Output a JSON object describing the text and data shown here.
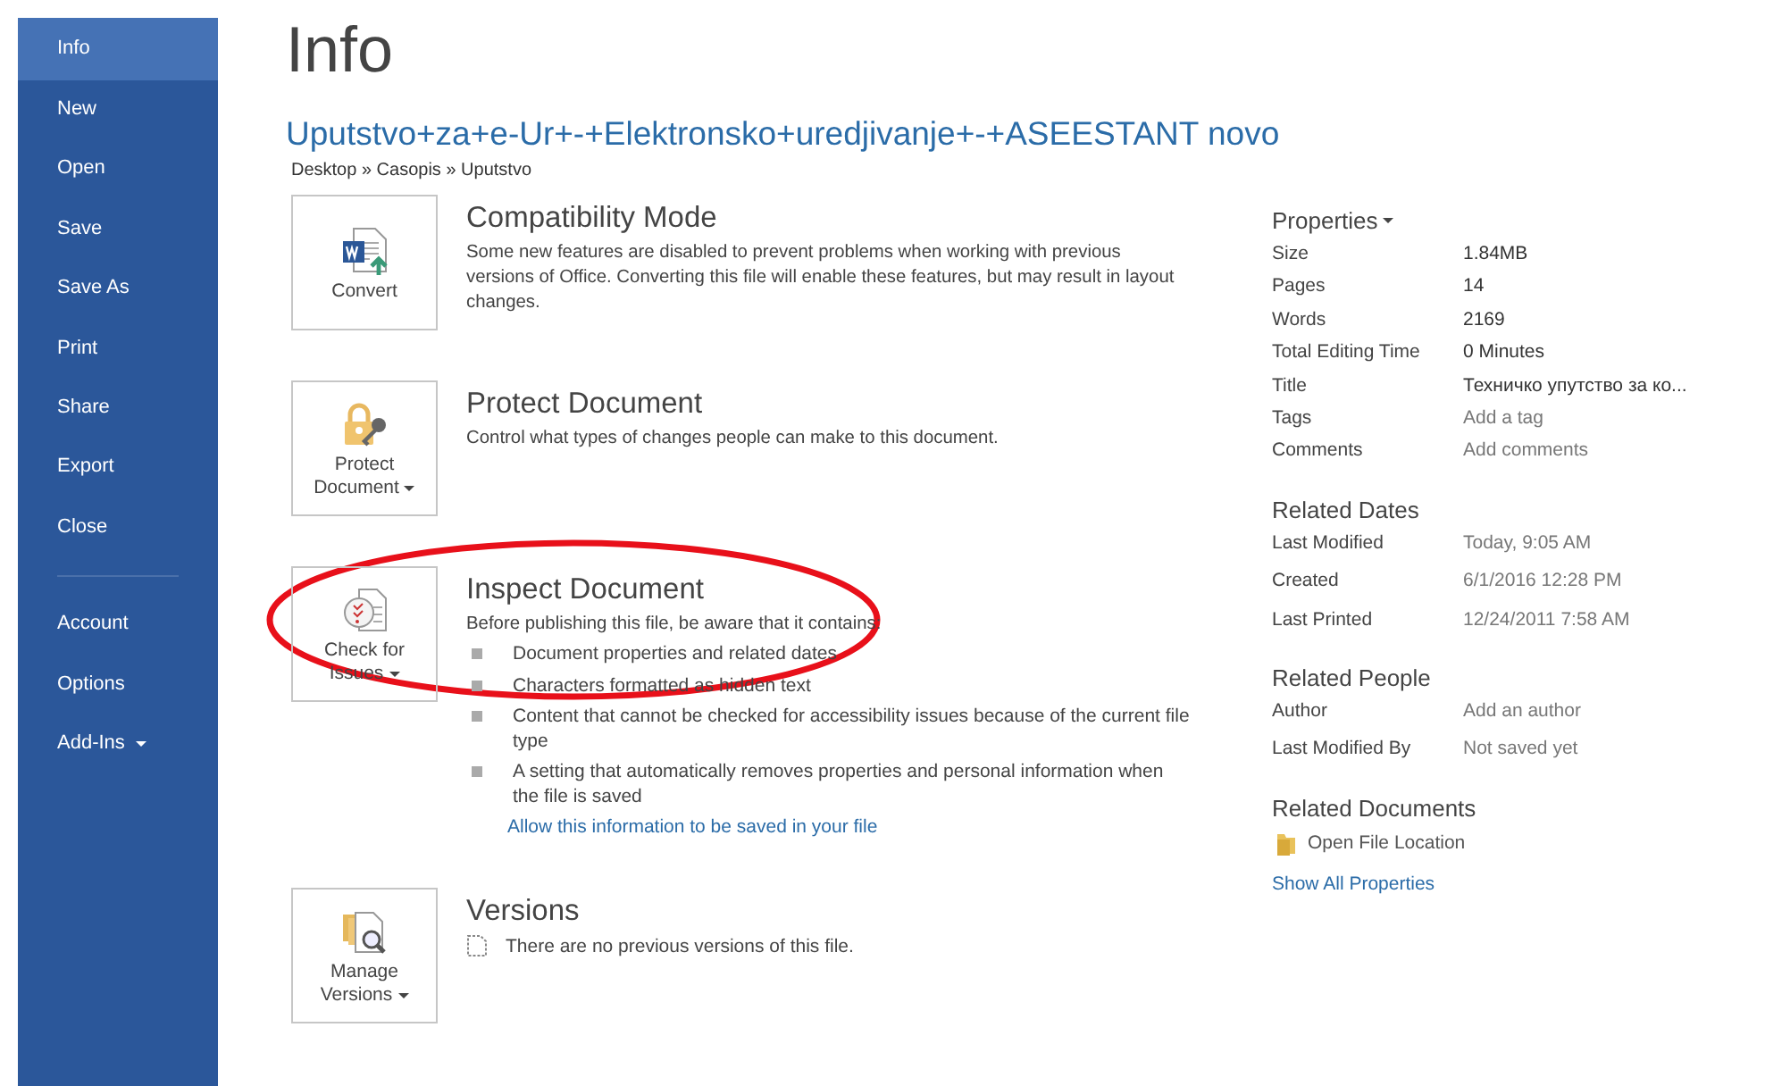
{
  "sidebar": {
    "groups": [
      {
        "items": [
          {
            "label": "Info",
            "selected": true,
            "dropdown": false
          },
          {
            "label": "New",
            "selected": false,
            "dropdown": false
          },
          {
            "label": "Open",
            "selected": false,
            "dropdown": false
          },
          {
            "label": "Save",
            "selected": false,
            "dropdown": false
          },
          {
            "label": "Save As",
            "selected": false,
            "dropdown": false
          },
          {
            "label": "Print",
            "selected": false,
            "dropdown": false
          },
          {
            "label": "Share",
            "selected": false,
            "dropdown": false
          },
          {
            "label": "Export",
            "selected": false,
            "dropdown": false
          },
          {
            "label": "Close",
            "selected": false,
            "dropdown": false
          }
        ]
      },
      {
        "items": [
          {
            "label": "Account",
            "selected": false,
            "dropdown": false
          },
          {
            "label": "Options",
            "selected": false,
            "dropdown": false
          },
          {
            "label": "Add-Ins",
            "selected": false,
            "dropdown": true
          }
        ]
      }
    ]
  },
  "page_title": "Info",
  "document_title": "Uputstvo+za+e-Ur+-+Elektronsko+uredjivanje+-+ASEESTANT novo",
  "path": "Desktop » Casopis » Uputstvo",
  "sections": [
    {
      "kind": "convert",
      "button": [
        "Convert"
      ],
      "dropdown": false,
      "heading": "Compatibility Mode",
      "text": "Some new features are disabled to prevent problems when working with previous versions of Office. Converting this file will enable these features, but may result in layout changes."
    },
    {
      "kind": "protect",
      "button": [
        "Protect",
        "Document"
      ],
      "dropdown": true,
      "heading": "Protect Document",
      "text": "Control what types of changes people can make to this document."
    },
    {
      "kind": "inspect",
      "button": [
        "Check for",
        "Issues"
      ],
      "dropdown": true,
      "heading": "Inspect Document",
      "text": "Before publishing this file, be aware that it contains:",
      "bullets": [
        "Document properties and related dates",
        "Characters formatted as hidden text",
        "Content that cannot be checked for accessibility issues because of the current file type",
        "A setting that automatically removes properties and personal information when the file is saved"
      ],
      "link": "Allow this information to be saved in your file",
      "annotated": true
    },
    {
      "kind": "versions",
      "button": [
        "Manage",
        "Versions"
      ],
      "dropdown": true,
      "heading": "Versions",
      "note": "There are no previous versions of this file."
    }
  ],
  "properties": {
    "heading": "Properties",
    "dropdown": true,
    "rows": [
      {
        "label": "Size",
        "value": "1.84MB",
        "placeholder": false
      },
      {
        "label": "Pages",
        "value": "14",
        "placeholder": false
      },
      {
        "label": "Words",
        "value": "2169",
        "placeholder": false
      },
      {
        "label": "Total Editing Time",
        "value": "0 Minutes",
        "placeholder": false
      },
      {
        "label": "Title",
        "value": "Техничко упутство за ко...",
        "placeholder": false
      },
      {
        "label": "Tags",
        "value": "Add a tag",
        "placeholder": true
      },
      {
        "label": "Comments",
        "value": "Add comments",
        "placeholder": true
      }
    ]
  },
  "related_dates": {
    "heading": "Related Dates",
    "rows": [
      {
        "label": "Last Modified",
        "value": "Today, 9:05 AM"
      },
      {
        "label": "Created",
        "value": "6/1/2016 12:28 PM"
      },
      {
        "label": "Last Printed",
        "value": "12/24/2011 7:58 AM"
      }
    ]
  },
  "related_people": {
    "heading": "Related People",
    "rows": [
      {
        "label": "Author",
        "value": "Add an author"
      },
      {
        "label": "Last Modified By",
        "value": "Not saved yet"
      }
    ]
  },
  "related_documents": {
    "heading": "Related Documents",
    "open_location": "Open File Location",
    "link": "Show All Properties"
  }
}
